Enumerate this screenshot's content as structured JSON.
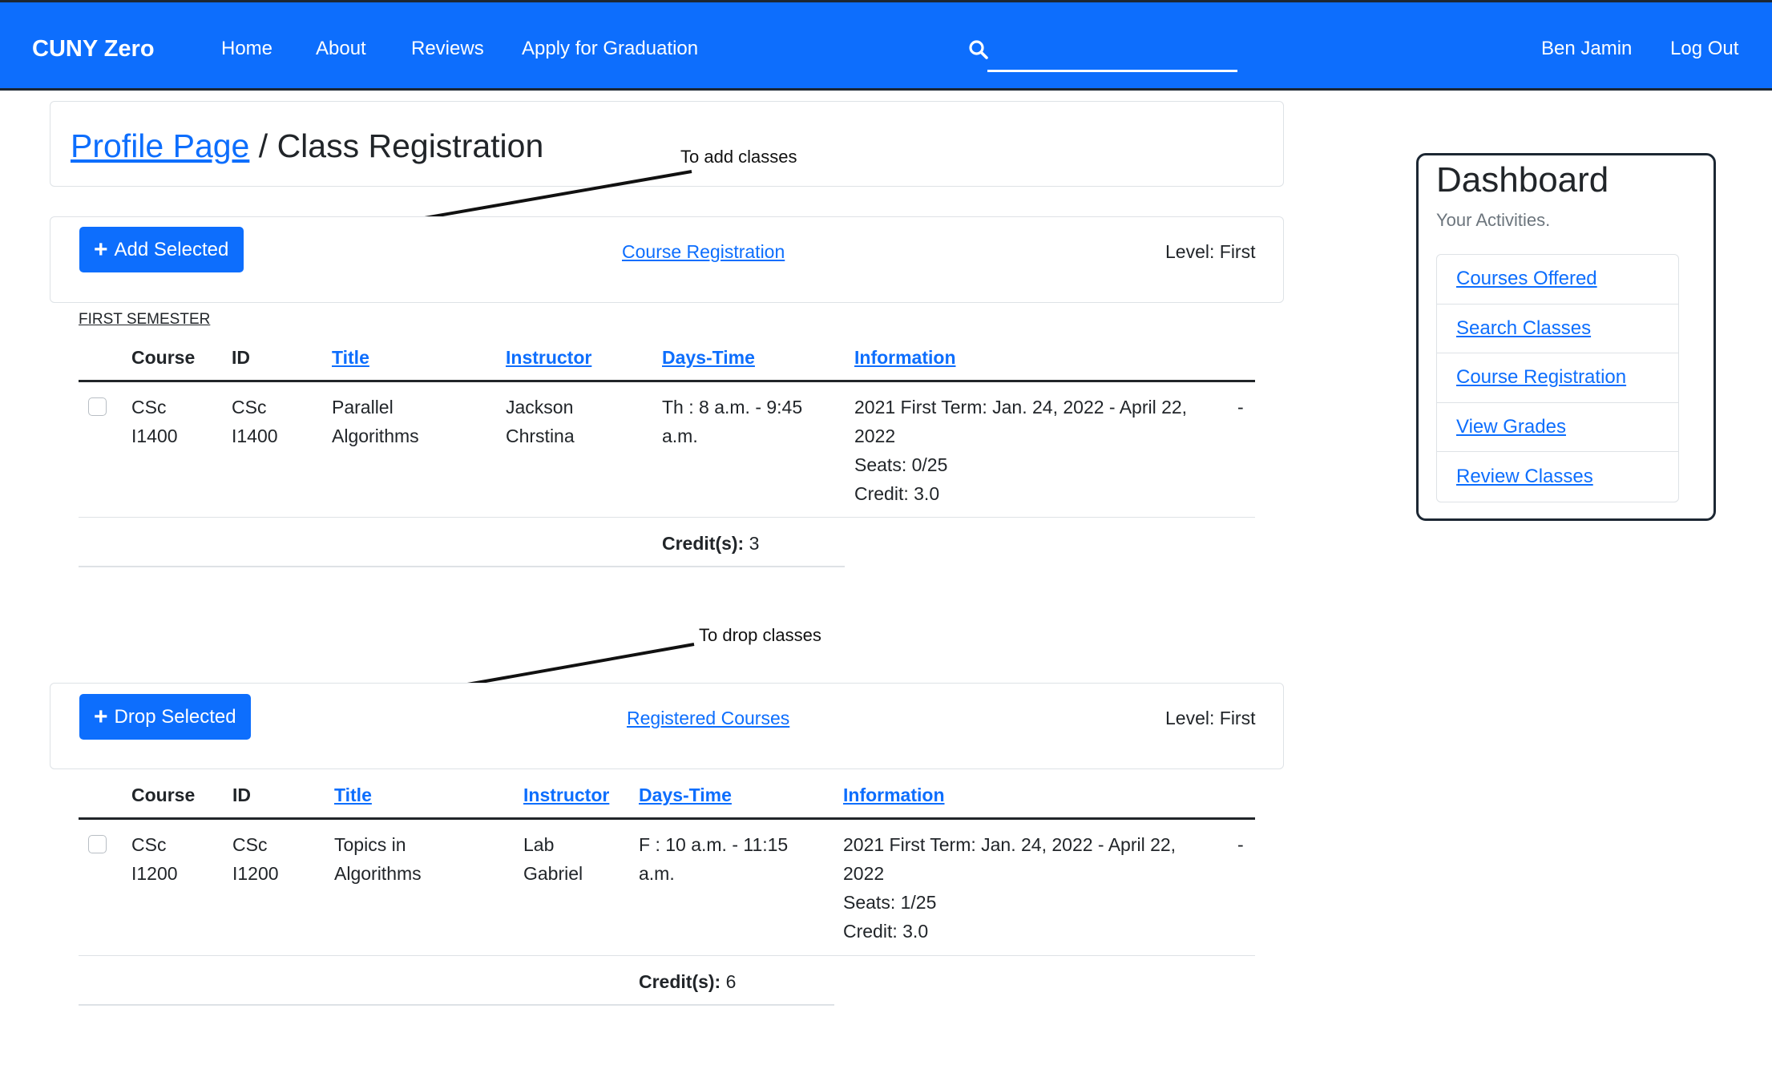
{
  "navbar": {
    "brand": "CUNY Zero",
    "links": [
      "Home",
      "About",
      "Reviews",
      "Apply for Graduation"
    ],
    "search_value": "",
    "user": "Ben Jamin",
    "logout": "Log Out"
  },
  "header": {
    "breadcrumb_link": "Profile Page",
    "separator": "/",
    "title": "Class Registration"
  },
  "annotations": {
    "add": "To add classes",
    "drop": "To drop classes"
  },
  "add_section": {
    "button": "Add Selected",
    "center_link": "Course Registration",
    "level": "Level: First",
    "semester": "FIRST SEMESTER",
    "headers": [
      "Course",
      "ID",
      "Title",
      "Instructor",
      "Days-Time",
      "Information"
    ],
    "row": {
      "course": [
        "CSc",
        "I1400"
      ],
      "id": [
        "CSc",
        "I1400"
      ],
      "title": [
        "Parallel",
        "Algorithms"
      ],
      "instructor": [
        "Jackson",
        "Chrstina"
      ],
      "days_time": [
        "Th : 8 a.m. - 9:45",
        "a.m."
      ],
      "information": [
        "2021 First Term: Jan. 24, 2022 - April 22,",
        "2022",
        "Seats: 0/25",
        "Credit: 3.0"
      ],
      "extra": "-"
    },
    "credits_label": "Credit(s):",
    "credits_value": "3"
  },
  "drop_section": {
    "button": "Drop Selected",
    "center_link": "Registered Courses",
    "level": "Level: First",
    "headers": [
      "Course",
      "ID",
      "Title",
      "Instructor",
      "Days-Time",
      "Information"
    ],
    "row": {
      "course": [
        "CSc",
        "I1200"
      ],
      "id": [
        "CSc",
        "I1200"
      ],
      "title": [
        "Topics in",
        "Algorithms"
      ],
      "instructor": [
        "Lab",
        "Gabriel"
      ],
      "days_time": [
        "F : 10 a.m. - 11:15",
        "a.m."
      ],
      "information": [
        "2021 First Term: Jan. 24, 2022 - April 22,",
        "2022",
        "Seats: 1/25",
        "Credit: 3.0"
      ],
      "extra": "-"
    },
    "credits_label": "Credit(s):",
    "credits_value": "6"
  },
  "dashboard": {
    "title": "Dashboard",
    "subtitle": "Your Activities.",
    "items": [
      "Courses Offered",
      "Search Classes",
      "Course Registration",
      "View Grades",
      "Review Classes"
    ]
  },
  "colors": {
    "primary": "#0d6efd",
    "dark": "#1c2733",
    "border": "#dee2e6"
  },
  "icons": {
    "search": "search-icon",
    "add": "plus-icon",
    "drop": "plus-icon"
  }
}
